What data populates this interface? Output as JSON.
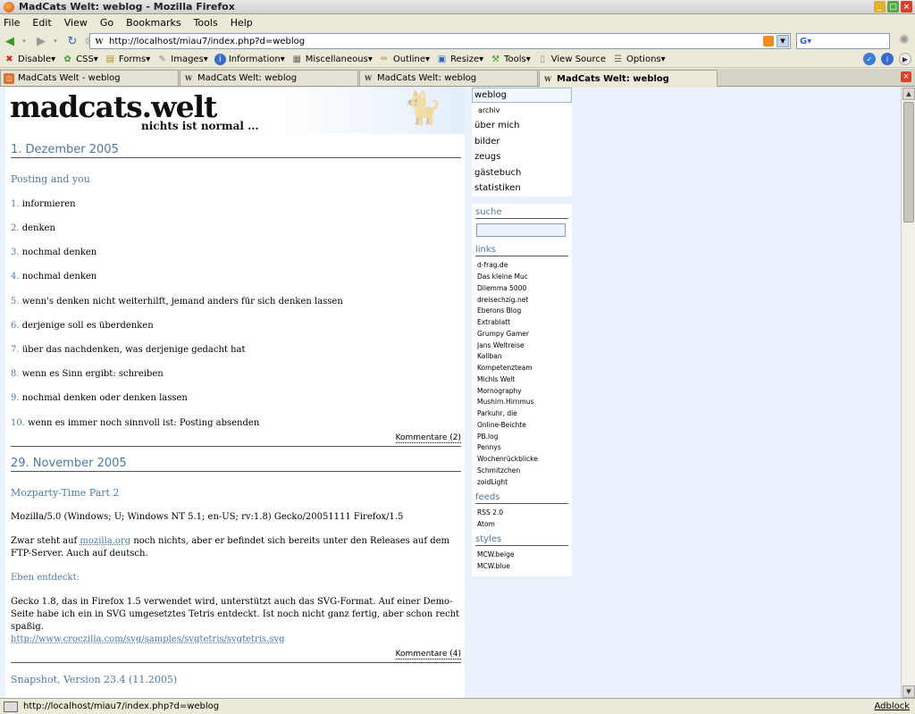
{
  "window": {
    "title": "MadCats Welt: weblog - Mozilla Firefox"
  },
  "menu": [
    "File",
    "Edit",
    "View",
    "Go",
    "Bookmarks",
    "Tools",
    "Help"
  ],
  "nav": {
    "url": "http://localhost/miau7/index.php?d=weblog",
    "search_value": ""
  },
  "devbar": [
    {
      "label": "Disable▾",
      "icon": "disable-icon"
    },
    {
      "label": "CSS▾",
      "icon": "css-icon"
    },
    {
      "label": "Forms▾",
      "icon": "forms-icon"
    },
    {
      "label": "Images▾",
      "icon": "images-icon"
    },
    {
      "label": "Information▾",
      "icon": "information-icon"
    },
    {
      "label": "Miscellaneous▾",
      "icon": "miscellaneous-icon"
    },
    {
      "label": "Outline▾",
      "icon": "outline-icon"
    },
    {
      "label": "Resize▾",
      "icon": "resize-icon"
    },
    {
      "label": "Tools▾",
      "icon": "tools-icon"
    },
    {
      "label": "View Source",
      "icon": "view-source-icon"
    },
    {
      "label": "Options▾",
      "icon": "options-icon"
    }
  ],
  "tabs": [
    {
      "label": "MadCats Welt - weblog"
    },
    {
      "label": "MadCats Welt: weblog"
    },
    {
      "label": "MadCats Welt: weblog"
    },
    {
      "label": "MadCats Welt: weblog"
    }
  ],
  "site": {
    "logo": "madcats.welt",
    "tagline": "nichts ist normal ...",
    "nav": [
      "weblog",
      "archiv",
      "über mich",
      "bilder",
      "zeugs",
      "gästebuch",
      "statistiken"
    ],
    "search_heading": "suche",
    "links_heading": "links",
    "links": [
      "d-frag.de",
      "Das kleine Muc",
      "Dilemma 5000",
      "dreisechzig.net",
      "Eberons Blog",
      "Extrablatt",
      "Grumpy Gamer",
      "Jans Weltreise",
      "Kaliban",
      "Kompetenzteam",
      "Michls Welt",
      "Mornography",
      "Mushirn.Hirnmus",
      "Parkuhr, die",
      "Online-Beichte",
      "PB.log",
      "Pennys",
      "Wochenrückblicke",
      "Schmitzchen",
      "zoidLight"
    ],
    "feeds_heading": "feeds",
    "feeds": [
      "RSS 2.0",
      "Atom"
    ],
    "styles_heading": "styles",
    "styles": [
      "MCW.beige",
      "MCW.blue"
    ]
  },
  "posts": {
    "date1": "1. Dezember 2005",
    "title1": "Posting and you",
    "list": [
      {
        "n": "1.",
        "t": "informieren"
      },
      {
        "n": "2.",
        "t": "denken"
      },
      {
        "n": "3.",
        "t": "nochmal denken"
      },
      {
        "n": "4.",
        "t": "nochmal denken"
      },
      {
        "n": "5.",
        "t": "wenn's denken nicht weiterhilft, jemand anders für sich denken lassen"
      },
      {
        "n": "6.",
        "t": "derjenige soll es überdenken"
      },
      {
        "n": "7.",
        "t": "über das nachdenken, was derjenige gedacht hat"
      },
      {
        "n": "8.",
        "t": "wenn es Sinn ergibt: schreiben"
      },
      {
        "n": "9.",
        "t": "nochmal denken oder denken lassen"
      },
      {
        "n": "10.",
        "t": "wenn es immer noch sinnvoll ist: Posting absenden"
      }
    ],
    "comments1": "Kommentare (2)",
    "date2": "29. November 2005",
    "title2": "Mozparty-Time Part 2",
    "ua": "Mozilla/5.0 (Windows; U; Windows NT 5.1; en-US; rv:1.8) Gecko/20051111 Firefox/1.5",
    "p1_a": "Zwar steht auf ",
    "p1_link": "mozilla.org",
    "p1_b": " noch nichts, aber er befindet sich bereits unter den Releases auf dem FTP-Server. Auch auf deutsch.",
    "sub": "Eben entdeckt:",
    "p2": "Gecko 1.8, das in Firefox 1.5 verwendet wird, unterstützt auch das SVG-Format. Auf einer Demo-Seite habe ich ein in SVG umgesetztes Tetris entdeckt. Ist noch nicht ganz fertig, aber schon recht spaßig.",
    "svg_url": "http://www.croczilla.com/svg/samples/svgtetris/svgtetris.svg",
    "comments2": "Kommentare (4)",
    "title3": "Snapshot, Version 23.4 (11.2005)"
  },
  "status": {
    "text": "http://localhost/miau7/index.php?d=weblog",
    "adblock": "Adblock"
  }
}
